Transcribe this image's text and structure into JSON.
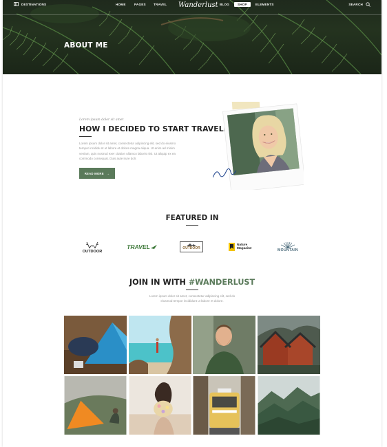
{
  "nav": {
    "left_label": "DESTINATIONS",
    "items": [
      "HOME",
      "PAGES",
      "TRAVEL",
      "BLOG",
      "SHOP",
      "ELEMENTS"
    ],
    "logo": "Wanderlust",
    "search_label": "SEARCH"
  },
  "hero": {
    "title": "ABOUT ME"
  },
  "about": {
    "kicker": "Lorem ipsum dolor sit amet",
    "title": "HOW I DECIDED TO START TRAVELING",
    "lines": [
      "Lorem ipsum dolor sit amet, consectetur adipiscing elit, sed do eiusmo",
      "tempor incididu nt ut labore et dolore magna aliqua. Ut enim ad minim",
      "veniam, quis nostrud exer citation ullamco laboris nisi. Ut aliquip ex ea",
      "commodo consequat. Duis aute irure dolr."
    ],
    "button": "READ MORE"
  },
  "featured": {
    "title": "FEATURED IN",
    "logos": [
      "OUTDOOR",
      "TRAVEL",
      "OUTDOOR",
      "Nature Magazine",
      "MOUNTAIN"
    ]
  },
  "join": {
    "title_prefix": "JOIN IN WITH ",
    "hashtag": "#WANDERLUST",
    "lines": [
      "Lorem ipsum dolor sit amet, consectetur adipiscing elit, sed do",
      "eiusmod tempor incididunt ut labore et dolore."
    ]
  },
  "gallery": {
    "tiles": [
      "tent-camp",
      "beach-cliff",
      "bearded-man",
      "cabins",
      "orange-tent",
      "flowers-girl",
      "tram-street",
      "mountains"
    ]
  },
  "colors": {
    "accent": "#5a7a5a",
    "hero_dark": "#1f2a1d",
    "text": "#222222",
    "muted": "#999999"
  }
}
